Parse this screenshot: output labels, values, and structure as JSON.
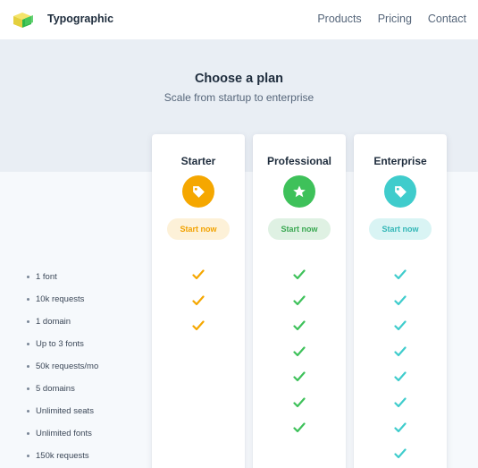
{
  "brand": {
    "name": "Typographic"
  },
  "nav": {
    "links": [
      "Products",
      "Pricing",
      "Contact"
    ]
  },
  "hero": {
    "title": "Choose a plan",
    "subtitle": "Scale from startup to enterprise"
  },
  "features": [
    "1 font",
    "10k requests",
    "1 domain",
    "Up to 3 fonts",
    "50k requests/mo",
    "5 domains",
    "Unlimited seats",
    "Unlimited fonts",
    "150k requests"
  ],
  "plans": [
    {
      "name": "Starter",
      "icon": "tag-icon",
      "button": "Start now",
      "accent": "#f5a700",
      "button_bg": "#fdf1d8",
      "button_text": "#f2a200",
      "checks": 3
    },
    {
      "name": "Professional",
      "icon": "star-icon",
      "button": "Start now",
      "accent": "#3ec15a",
      "button_bg": "#dff1e3",
      "button_text": "#3aa852",
      "checks": 7
    },
    {
      "name": "Enterprise",
      "icon": "tag-icon",
      "button": "Start now",
      "accent": "#3fcccc",
      "button_bg": "#d9f4f4",
      "button_text": "#33b7b7",
      "checks": 8
    }
  ]
}
